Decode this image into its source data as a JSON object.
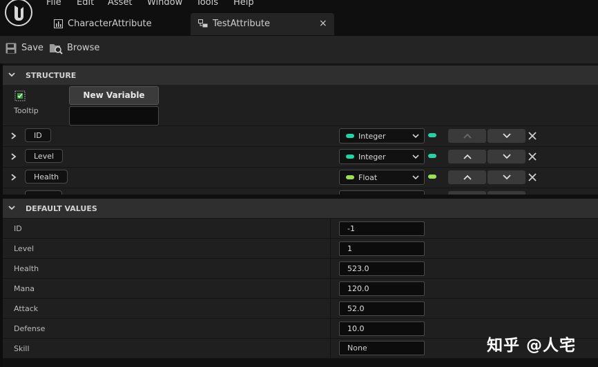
{
  "menu": [
    "File",
    "Edit",
    "Asset",
    "Window",
    "Tools",
    "Help"
  ],
  "tabs": [
    {
      "label": "CharacterAttribute",
      "icon": "chart-icon",
      "active": false
    },
    {
      "label": "TestAttribute",
      "icon": "struct-icon",
      "active": true,
      "close": "×"
    }
  ],
  "toolbar": {
    "save_label": "Save",
    "browse_label": "Browse"
  },
  "structure": {
    "title": "STRUCTURE",
    "new_variable_label": "New Variable",
    "tooltip_label": "Tooltip",
    "tooltip_value": "",
    "variables": [
      {
        "name": "ID",
        "type": "Integer",
        "color": "#1ed5a5"
      },
      {
        "name": "Level",
        "type": "Integer",
        "color": "#1ed5a5"
      },
      {
        "name": "Health",
        "type": "Float",
        "color": "#9be14a"
      }
    ]
  },
  "default_values": {
    "title": "DEFAULT VALUES",
    "rows": [
      {
        "label": "ID",
        "value": "-1"
      },
      {
        "label": "Level",
        "value": "1"
      },
      {
        "label": "Health",
        "value": "523.0"
      },
      {
        "label": "Mana",
        "value": "120.0"
      },
      {
        "label": "Attack",
        "value": "52.0"
      },
      {
        "label": "Defense",
        "value": "10.0"
      },
      {
        "label": "Skill",
        "value": "None"
      }
    ]
  },
  "watermark": "知乎 @人宅"
}
